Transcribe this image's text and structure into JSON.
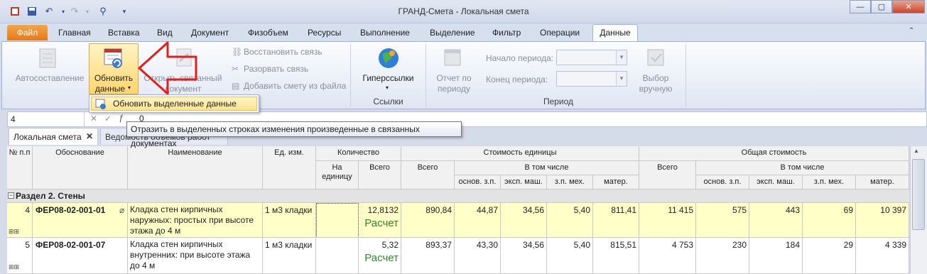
{
  "window": {
    "title": "ГРАНД-Смета - Локальная смета"
  },
  "ribbon_tabs": [
    "Файл",
    "Главная",
    "Вставка",
    "Вид",
    "Документ",
    "Физобъем",
    "Ресурсы",
    "Выполнение",
    "Выделение",
    "Фильтр",
    "Операции",
    "Данные"
  ],
  "ribbon": {
    "autosostavlenie": "Автосоставление",
    "refresh_line1": "Обновить",
    "refresh_line2": "данные",
    "open_linked_line1": "Открыть связанный",
    "open_linked_line2": "документ",
    "restore_link": "Восстановить связь",
    "break_link": "Разорвать связь",
    "add_from_file": "Добавить смету из файла",
    "hyperlinks": "Гиперссылки",
    "group_links": "Ссылки",
    "report_line1": "Отчет по",
    "report_line2": "периоду",
    "period_start": "Начало периода:",
    "period_end": "Конец периода:",
    "manual_line1": "Выбор",
    "manual_line2": "вручную",
    "group_period": "Период"
  },
  "dropdown": {
    "item": "Обновить выделенные данные"
  },
  "tooltip": "Отразить в выделенных строках изменения произведенные в связанных документах",
  "formula": {
    "cell_ref": "4",
    "value": "0"
  },
  "doc_tabs": {
    "active": "Локальная смета",
    "second": "Ведомость объемов работ"
  },
  "grid": {
    "headers": {
      "num": "№ п.п",
      "basis": "Обоснование",
      "name": "Наименование",
      "unit": "Ед. изм.",
      "qty": "Количество",
      "qty_per_unit": "На единицу",
      "qty_total": "Всего",
      "unit_cost": "Стоимость единицы",
      "total_cost": "Общая стоимость",
      "all": "Всего",
      "incl": "В том числе",
      "osn_zp": "основ. з.п.",
      "eksp_mash": "эксп. маш.",
      "zp_meh": "з.п. мех.",
      "mater": "матер."
    },
    "section": "Раздел 2. Стены",
    "rows": [
      {
        "num": "4",
        "basis": "ФЕР08-02-001-01",
        "name": "Кладка стен кирпичных наружных: простых при высоте этажа до 4 м",
        "unit": "1 м3 кладки",
        "qty_total": "12,8132",
        "calc": "Расчет",
        "u_all": "890,84",
        "u_osn": "44,87",
        "u_eksp": "34,56",
        "u_zpmeh": "5,40",
        "u_mater": "811,41",
        "t_all": "11 415",
        "t_osn": "575",
        "t_eksp": "443",
        "t_zpmeh": "69",
        "t_mater": "10 397"
      },
      {
        "num": "5",
        "basis": "ФЕР08-02-001-07",
        "name": "Кладка стен кирпичных внутренних: при высоте этажа до 4 м",
        "unit": "1 м3 кладки",
        "qty_total": "5,32",
        "calc": "Расчет",
        "u_all": "893,37",
        "u_osn": "43,30",
        "u_eksp": "34,56",
        "u_zpmeh": "5,40",
        "u_mater": "815,51",
        "t_all": "4 753",
        "t_osn": "230",
        "t_eksp": "184",
        "t_zpmeh": "29",
        "t_mater": "4 339"
      }
    ]
  }
}
